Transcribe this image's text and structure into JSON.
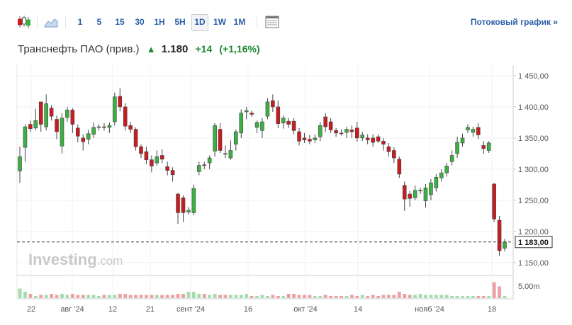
{
  "toolbar": {
    "icons": [
      "candlestick-icon",
      "area-chart-icon",
      "table-icon"
    ],
    "intervals": [
      "1",
      "5",
      "15",
      "30",
      "1H",
      "5H",
      "1D",
      "1W",
      "1M"
    ],
    "active_interval": "1D",
    "stream_label": "Потоковый график »"
  },
  "quote": {
    "name": "Транснефть ПАО (прив.)",
    "direction_icon": "arrow-up-icon",
    "price": "1.180",
    "change": "+14",
    "change_pct": "(+1,16%)",
    "up_color": "#1c8a32"
  },
  "watermark": {
    "brand": "Investing",
    "suffix": ".com"
  },
  "colors": {
    "up": "#3cb043",
    "down": "#c91c22",
    "volume_up": "#a6ddb0",
    "volume_down": "#eba3a6"
  },
  "chart_data": {
    "type": "candlestick",
    "y_axis": {
      "ticks": [
        "1 450,00",
        "1 400,00",
        "1 350,00",
        "1 300,00",
        "1 250,00",
        "1 200,00",
        "1 150,00"
      ],
      "tick_values": [
        1450,
        1400,
        1350,
        1300,
        1250,
        1200,
        1150
      ],
      "ylim": [
        1135,
        1467
      ]
    },
    "x_axis": {
      "ticks": [
        "22",
        "авг '24",
        "12",
        "21",
        "сент '24",
        "16",
        "окт '24",
        "14",
        "нояб '24",
        "18"
      ]
    },
    "last_price_label": "1 183,00",
    "last_price": 1183,
    "volume_axis_label": "5.00m",
    "grid": true,
    "candles": [
      [
        1297,
        1320,
        1278,
        1336
      ],
      [
        1335,
        1368,
        1312,
        1372
      ],
      [
        1372,
        1365,
        1378,
        1360
      ],
      [
        1366,
        1378,
        1362,
        1397
      ],
      [
        1408,
        1372,
        1408,
        1360
      ],
      [
        1368,
        1405,
        1362,
        1420
      ],
      [
        1398,
        1385,
        1403,
        1378
      ],
      [
        1380,
        1360,
        1386,
        1348
      ],
      [
        1337,
        1382,
        1325,
        1390
      ],
      [
        1383,
        1395,
        1376,
        1400
      ],
      [
        1395,
        1372,
        1398,
        1358
      ],
      [
        1366,
        1353,
        1372,
        1343
      ],
      [
        1350,
        1344,
        1356,
        1330
      ],
      [
        1348,
        1357,
        1340,
        1363
      ],
      [
        1356,
        1367,
        1350,
        1375
      ],
      [
        1368,
        1368,
        1362,
        1372
      ],
      [
        1368,
        1367,
        1362,
        1374
      ],
      [
        1367,
        1370,
        1358,
        1375
      ],
      [
        1376,
        1416,
        1370,
        1423
      ],
      [
        1417,
        1400,
        1430,
        1393
      ],
      [
        1400,
        1369,
        1406,
        1362
      ],
      [
        1370,
        1364,
        1376,
        1358
      ],
      [
        1364,
        1336,
        1367,
        1330
      ],
      [
        1336,
        1325,
        1340,
        1318
      ],
      [
        1328,
        1315,
        1336,
        1308
      ],
      [
        1315,
        1305,
        1322,
        1295
      ],
      [
        1310,
        1320,
        1305,
        1330
      ],
      [
        1322,
        1316,
        1332,
        1310
      ],
      [
        1304,
        1298,
        1312,
        1290
      ],
      [
        1298,
        1291,
        1303,
        1280
      ],
      [
        1260,
        1230,
        1262,
        1212
      ],
      [
        1254,
        1230,
        1258,
        1215
      ],
      [
        1231,
        1234,
        1227,
        1239
      ],
      [
        1230,
        1269,
        1226,
        1275
      ],
      [
        1296,
        1306,
        1290,
        1312
      ],
      [
        1307,
        1306,
        1312,
        1300
      ],
      [
        1310,
        1318,
        1300,
        1322
      ],
      [
        1329,
        1370,
        1320,
        1374
      ],
      [
        1364,
        1330,
        1374,
        1326
      ],
      [
        1325,
        1324,
        1338,
        1318
      ],
      [
        1318,
        1330,
        1315,
        1346
      ],
      [
        1340,
        1360,
        1330,
        1364
      ],
      [
        1358,
        1390,
        1350,
        1396
      ],
      [
        1392,
        1394,
        1380,
        1400
      ],
      [
        1390,
        1388,
        1394,
        1384
      ],
      [
        1367,
        1375,
        1358,
        1378
      ],
      [
        1362,
        1376,
        1350,
        1382
      ],
      [
        1385,
        1408,
        1380,
        1414
      ],
      [
        1410,
        1400,
        1420,
        1392
      ],
      [
        1400,
        1373,
        1410,
        1366
      ],
      [
        1374,
        1382,
        1365,
        1386
      ],
      [
        1377,
        1372,
        1382,
        1366
      ],
      [
        1377,
        1362,
        1382,
        1356
      ],
      [
        1360,
        1345,
        1366,
        1338
      ],
      [
        1350,
        1347,
        1358,
        1342
      ],
      [
        1348,
        1345,
        1355,
        1340
      ],
      [
        1347,
        1350,
        1342,
        1356
      ],
      [
        1352,
        1370,
        1345,
        1376
      ],
      [
        1384,
        1368,
        1390,
        1360
      ],
      [
        1376,
        1363,
        1382,
        1358
      ],
      [
        1362,
        1358,
        1366,
        1352
      ],
      [
        1358,
        1357,
        1364,
        1354
      ],
      [
        1359,
        1364,
        1350,
        1368
      ],
      [
        1363,
        1360,
        1370,
        1350
      ],
      [
        1366,
        1350,
        1376,
        1344
      ],
      [
        1350,
        1355,
        1345,
        1360
      ],
      [
        1350,
        1347,
        1356,
        1340
      ],
      [
        1350,
        1343,
        1356,
        1336
      ],
      [
        1352,
        1345,
        1356,
        1342
      ],
      [
        1345,
        1340,
        1350,
        1330
      ],
      [
        1336,
        1328,
        1342,
        1320
      ],
      [
        1330,
        1318,
        1335,
        1310
      ],
      [
        1316,
        1292,
        1320,
        1286
      ],
      [
        1274,
        1252,
        1280,
        1233
      ],
      [
        1260,
        1253,
        1265,
        1240
      ],
      [
        1254,
        1266,
        1250,
        1274
      ],
      [
        1266,
        1266,
        1270,
        1260
      ],
      [
        1249,
        1270,
        1238,
        1276
      ],
      [
        1259,
        1278,
        1250,
        1284
      ],
      [
        1270,
        1287,
        1264,
        1292
      ],
      [
        1286,
        1294,
        1280,
        1300
      ],
      [
        1294,
        1305,
        1288,
        1310
      ],
      [
        1312,
        1322,
        1306,
        1330
      ],
      [
        1325,
        1343,
        1318,
        1352
      ],
      [
        1342,
        1350,
        1336,
        1357
      ],
      [
        1363,
        1367,
        1358,
        1372
      ],
      [
        1359,
        1364,
        1352,
        1368
      ],
      [
        1367,
        1355,
        1374,
        1348
      ],
      [
        1338,
        1333,
        1345,
        1325
      ],
      [
        1330,
        1342,
        1326,
        1345
      ],
      [
        1276,
        1220,
        1278,
        1215
      ],
      [
        1218,
        1169,
        1225,
        1161
      ],
      [
        1173,
        1183,
        1168,
        1188
      ]
    ],
    "volume": [
      0.09,
      0.06,
      0.04,
      0.02,
      0.03,
      0.03,
      0.04,
      0.03,
      0.04,
      0.03,
      0.04,
      0.03,
      0.03,
      0.03,
      0.03,
      0.02,
      0.03,
      0.03,
      0.03,
      0.04,
      0.04,
      0.03,
      0.03,
      0.03,
      0.03,
      0.03,
      0.03,
      0.03,
      0.03,
      0.03,
      0.04,
      0.04,
      0.06,
      0.06,
      0.04,
      0.04,
      0.03,
      0.04,
      0.03,
      0.03,
      0.03,
      0.03,
      0.03,
      0.04,
      0.02,
      0.02,
      0.03,
      0.02,
      0.03,
      0.02,
      0.02,
      0.04,
      0.04,
      0.03,
      0.03,
      0.03,
      0.02,
      0.02,
      0.03,
      0.02,
      0.02,
      0.02,
      0.02,
      0.03,
      0.02,
      0.03,
      0.02,
      0.03,
      0.02,
      0.03,
      0.03,
      0.03,
      0.06,
      0.04,
      0.03,
      0.03,
      0.04,
      0.03,
      0.03,
      0.03,
      0.03,
      0.03,
      0.02,
      0.02,
      0.02,
      0.02,
      0.02,
      0.02,
      0.02,
      0.02,
      0.15,
      0.11,
      0.02
    ]
  }
}
